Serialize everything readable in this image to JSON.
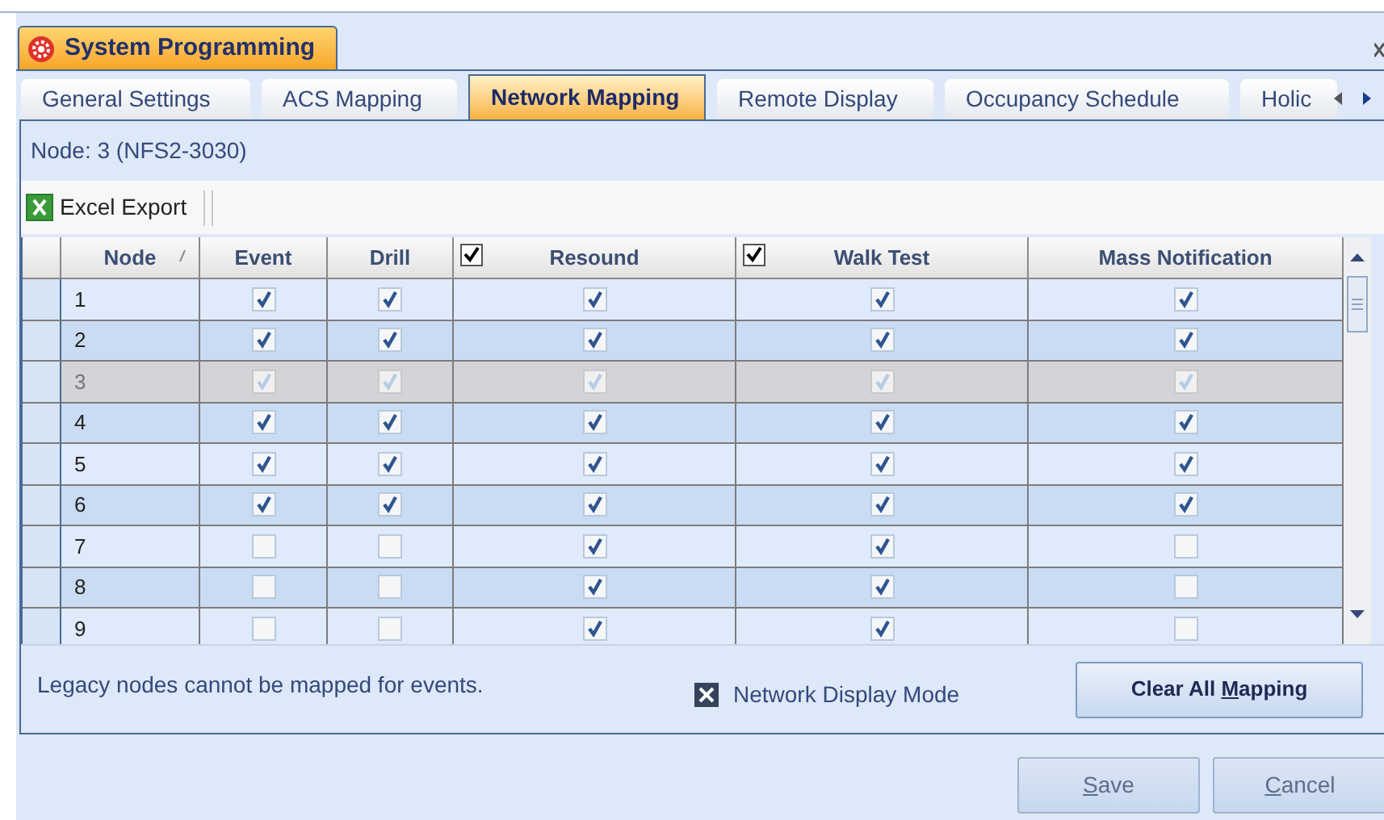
{
  "window": {
    "title": "System Programming"
  },
  "tabs": [
    {
      "label": "General Settings",
      "selected": false
    },
    {
      "label": "ACS Mapping",
      "selected": false
    },
    {
      "label": "Network Mapping",
      "selected": true
    },
    {
      "label": "Remote Display",
      "selected": false
    },
    {
      "label": "Occupancy Schedule",
      "selected": false
    },
    {
      "label": "Holic",
      "selected": false
    }
  ],
  "node_label": "Node: 3 (NFS2-3030)",
  "toolbar": {
    "export_button": "Excel Export"
  },
  "table": {
    "columns": [
      {
        "kind": "text",
        "label": "Node"
      },
      {
        "kind": "check",
        "label": "Event"
      },
      {
        "kind": "check",
        "label": "Drill"
      },
      {
        "kind": "check",
        "label": "Resound",
        "checked": true
      },
      {
        "kind": "check",
        "label": "Walk Test",
        "checked": true
      },
      {
        "kind": "check",
        "label": "Mass Notification"
      }
    ],
    "rows": [
      {
        "node": "1",
        "disabled": false,
        "checks": [
          true,
          true,
          true,
          true,
          true
        ]
      },
      {
        "node": "2",
        "disabled": false,
        "checks": [
          true,
          true,
          true,
          true,
          true
        ]
      },
      {
        "node": "3",
        "disabled": true,
        "checks": [
          true,
          true,
          true,
          true,
          true
        ]
      },
      {
        "node": "4",
        "disabled": false,
        "checks": [
          true,
          true,
          true,
          true,
          true
        ]
      },
      {
        "node": "5",
        "disabled": false,
        "checks": [
          true,
          true,
          true,
          true,
          true
        ]
      },
      {
        "node": "6",
        "disabled": false,
        "checks": [
          true,
          true,
          true,
          true,
          true
        ]
      },
      {
        "node": "7",
        "disabled": false,
        "checks": [
          false,
          false,
          true,
          true,
          false
        ]
      },
      {
        "node": "8",
        "disabled": false,
        "checks": [
          false,
          false,
          true,
          true,
          false
        ]
      },
      {
        "node": "9",
        "disabled": false,
        "checks": [
          false,
          false,
          true,
          true,
          false
        ]
      }
    ]
  },
  "footer": {
    "note": "Legacy nodes cannot be mapped for events.",
    "display_mode": {
      "label": "Network Display Mode",
      "checked": true
    },
    "clear_button": {
      "before": "Clear All ",
      "mnemonic": "M",
      "after": "apping"
    }
  },
  "buttons": [
    {
      "mnemonic": "S",
      "after": "ave"
    },
    {
      "mnemonic": "C",
      "after": "ancel"
    }
  ]
}
